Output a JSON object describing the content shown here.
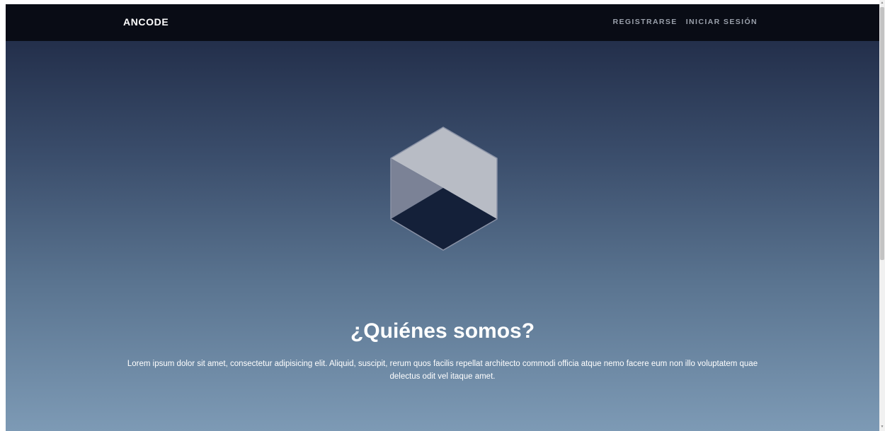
{
  "navbar": {
    "brand": "ANCODE",
    "links": [
      {
        "label": "REGISTRARSE"
      },
      {
        "label": "INICIAR SESIÓN"
      }
    ]
  },
  "hero": {
    "title": "¿Quiénes somos?",
    "description": "Lorem ipsum dolor sit amet, consectetur adipisicing elit. Aliquid, suscipit, rerum quos facilis repellat architecto commodi officia atque nemo facere eum non illo voluptatem quae delectus odit vel itaque amet.",
    "logo_icon": "hexagon-cube-icon"
  },
  "colors": {
    "navbar_bg": "#090c15",
    "hero_top": "#232f4b",
    "hero_bottom": "#7d9ab5",
    "cube_top": "#b8bcc5",
    "cube_left": "#7b8296",
    "cube_bottom": "#142039"
  }
}
